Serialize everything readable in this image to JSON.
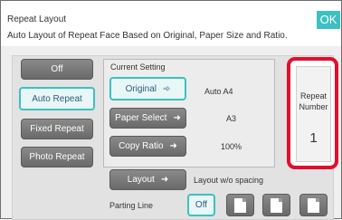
{
  "header": {
    "title": "Repeat Layout",
    "subtitle": "Auto Layout of Repeat Face Based on Original, Paper Size and Ratio.",
    "ok_label": "OK"
  },
  "modes": {
    "off": "Off",
    "auto_repeat": "Auto Repeat",
    "fixed_repeat": "Fixed Repeat",
    "photo_repeat": "Photo Repeat",
    "selected": "Auto Repeat"
  },
  "current_setting": {
    "label": "Current Setting",
    "original_label": "Original",
    "original_value": "Auto   A4",
    "paper_select_label": "Paper Select",
    "paper_select_value": "A3",
    "copy_ratio_label": "Copy Ratio",
    "copy_ratio_value": "100%"
  },
  "repeat_number": {
    "label": "Repeat Number",
    "value": "1"
  },
  "layout": {
    "label": "Layout",
    "value": "Layout w/o spacing"
  },
  "parting_line": {
    "label": "Parting Line",
    "off_label": "Off",
    "selected": "Off"
  },
  "colors": {
    "accent": "#3cc0c2",
    "highlight": "#e10f2d",
    "button": "#7a7a7a"
  }
}
